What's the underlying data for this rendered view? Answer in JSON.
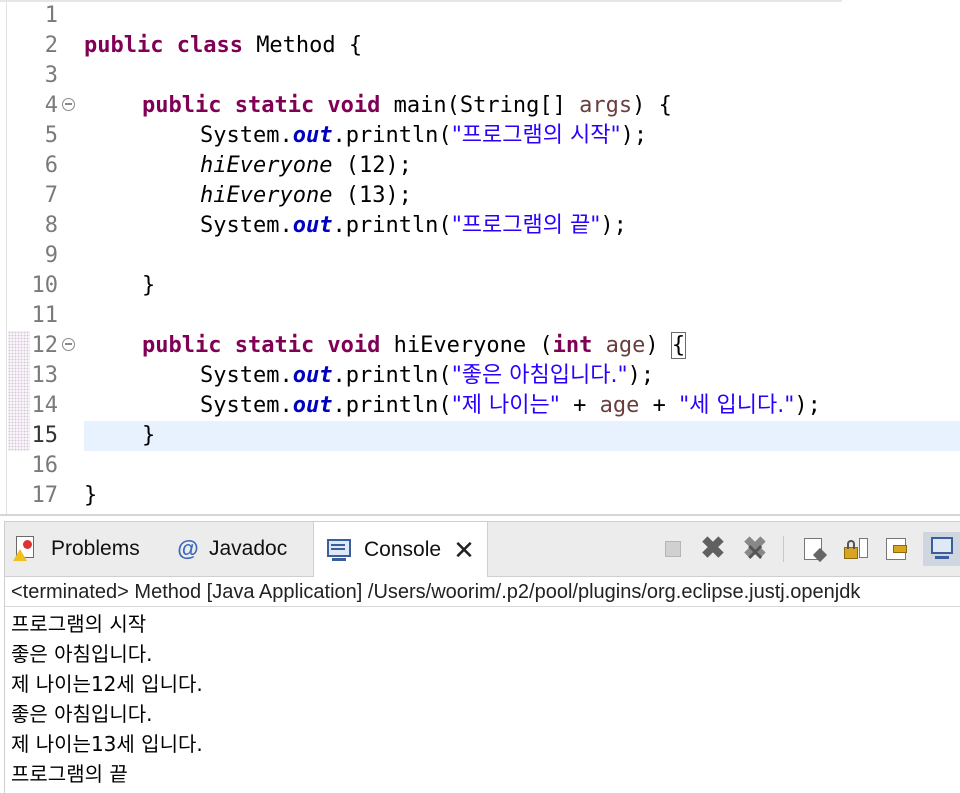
{
  "editor": {
    "lines": [
      {
        "num": "1"
      },
      {
        "num": "2",
        "kw": "public class ",
        "name": "Method {"
      },
      {
        "num": "3"
      },
      {
        "num": "4",
        "kw": "public static void ",
        "rest": "main(String[] ",
        "param": "args",
        "tail": ") {"
      },
      {
        "num": "5",
        "pre": "System.",
        "field": "out",
        "mid": ".println(",
        "str": "\"프로그램의 시작\"",
        "tail": ");"
      },
      {
        "num": "6",
        "method": "hiEveryone",
        "tail": " (12);"
      },
      {
        "num": "7",
        "method": "hiEveryone",
        "tail": " (13);"
      },
      {
        "num": "8",
        "pre": "System.",
        "field": "out",
        "mid": ".println(",
        "str": "\"프로그램의 끝\"",
        "tail": ");"
      },
      {
        "num": "9"
      },
      {
        "num": "10",
        "text": "}"
      },
      {
        "num": "11"
      },
      {
        "num": "12",
        "kw": "public static void ",
        "rest": "hiEveryone (",
        "kw2": "int ",
        "param": "age",
        "tail": ") ",
        "brace": "{"
      },
      {
        "num": "13",
        "pre": "System.",
        "field": "out",
        "mid": ".println(",
        "str": "\"좋은 아침입니다.\"",
        "tail": ");"
      },
      {
        "num": "14",
        "pre": "System.",
        "field": "out",
        "mid": ".println(",
        "str": "\"제 나이는\"",
        "op1": " + ",
        "var": "age",
        "op2": " + ",
        "str2": "\"세 입니다.\"",
        "tail": ");"
      },
      {
        "num": "15",
        "text": "}"
      },
      {
        "num": "16"
      },
      {
        "num": "17",
        "text": "}"
      }
    ]
  },
  "console": {
    "tabs": {
      "problems": "Problems",
      "javadoc": "Javadoc",
      "console": "Console",
      "javadoc_symbol": "@",
      "close_symbol": "✕"
    },
    "toolbar_icons": [
      "stop-icon",
      "remove-launch-icon",
      "remove-all-terminated-icon",
      "scroll-lock-icon",
      "pin-console-icon",
      "display-selected-console-icon",
      "open-console-icon"
    ],
    "status": "<terminated> Method [Java Application] /Users/woorim/.p2/pool/plugins/org.eclipse.justj.openjdk",
    "output": [
      "프로그램의 시작",
      "좋은 아침입니다.",
      "제 나이는12세 입니다.",
      "좋은 아침입니다.",
      "제 나이는13세 입니다.",
      "프로그램의 끝"
    ]
  },
  "colors": {
    "keyword": "#7f0055",
    "string": "#2a00ff",
    "static_field": "#0000c0",
    "local_var": "#6a3e3e",
    "current_line": "#e8f2fe"
  }
}
